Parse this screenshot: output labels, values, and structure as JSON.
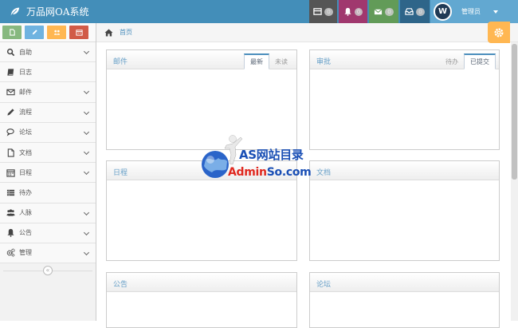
{
  "app": {
    "title": "万品网OA系统"
  },
  "header": {
    "notifications": [
      {
        "icon": "tasks-icon",
        "count": "0",
        "bg": "#555555"
      },
      {
        "icon": "bell-icon",
        "count": "0",
        "bg": "#a0386e"
      },
      {
        "icon": "envelope-icon",
        "count": "0",
        "bg": "#629b58"
      },
      {
        "icon": "inbox-icon",
        "count": "0",
        "bg": "#2e6589"
      }
    ],
    "user": {
      "avatar_letter": "W",
      "name": "管理员"
    }
  },
  "shortcuts": [
    {
      "icon": "file-icon",
      "bg": "#87b87f"
    },
    {
      "icon": "pencil-icon",
      "bg": "#6fb3e0"
    },
    {
      "icon": "group-icon",
      "bg": "#ffb752"
    },
    {
      "icon": "calendar-icon",
      "bg": "#d15b47"
    }
  ],
  "sidebar": {
    "items": [
      {
        "label": "自助",
        "icon": "search-icon",
        "has_sub": true
      },
      {
        "label": "日志",
        "icon": "book-icon",
        "has_sub": false
      },
      {
        "label": "邮件",
        "icon": "envelope-icon",
        "has_sub": true
      },
      {
        "label": "流程",
        "icon": "pencil-icon",
        "has_sub": true
      },
      {
        "label": "论坛",
        "icon": "comments-icon",
        "has_sub": true
      },
      {
        "label": "文档",
        "icon": "file-icon",
        "has_sub": true
      },
      {
        "label": "日程",
        "icon": "calendar-icon",
        "has_sub": true
      },
      {
        "label": "待办",
        "icon": "list-icon",
        "has_sub": false
      },
      {
        "label": "人脉",
        "icon": "users-icon",
        "has_sub": true
      },
      {
        "label": "公告",
        "icon": "bell-icon",
        "has_sub": true
      },
      {
        "label": "管理",
        "icon": "cogs-icon",
        "has_sub": true
      }
    ],
    "collapse_glyph": "«"
  },
  "breadcrumb": {
    "home_icon": "home-icon",
    "current": "首页"
  },
  "widgets": {
    "mail": {
      "title": "邮件",
      "tabs": [
        "最新",
        "未读"
      ],
      "active_tab": 0
    },
    "approval": {
      "title": "审批",
      "tabs": [
        "待办",
        "已提交"
      ],
      "active_tab": 1
    },
    "schedule": {
      "title": "日程"
    },
    "docs": {
      "title": "文档"
    },
    "notice": {
      "title": "公告"
    },
    "forum": {
      "title": "论坛"
    }
  },
  "watermark": {
    "line1": "AS网站目录",
    "line2_red": "Admin",
    "line2_blue": "So.com"
  }
}
